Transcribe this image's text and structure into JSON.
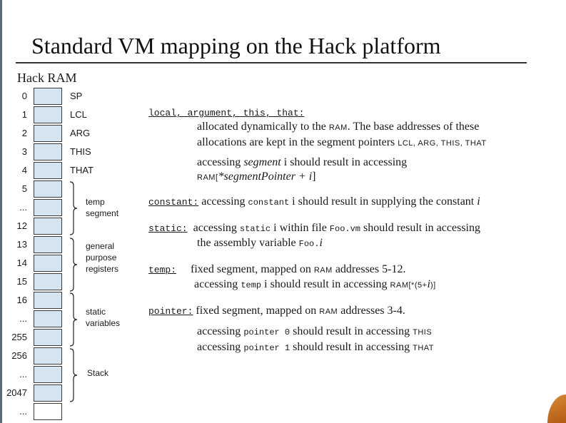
{
  "slide": {
    "title": "Standard VM mapping on the Hack platform",
    "ram_heading": "Hack RAM"
  },
  "ram": {
    "addresses": [
      "0",
      "1",
      "2",
      "3",
      "4",
      "5",
      "...",
      "12",
      "13",
      "14",
      "15",
      "16",
      "...",
      "255",
      "256",
      "...",
      "2047",
      "..."
    ],
    "registers": [
      "SP",
      "LCL",
      "ARG",
      "THIS",
      "THAT"
    ],
    "groups": {
      "temp": [
        "temp",
        "segment"
      ],
      "general": [
        "general",
        "purpose",
        "registers"
      ],
      "static": [
        "static",
        "variables"
      ],
      "stack": [
        "Stack"
      ]
    }
  },
  "segments": {
    "dynamic": {
      "keyword": "local, argument, this, that:",
      "line1": "allocated dynamically to the ",
      "line1_ram": "RAM",
      "line1_end": ". The base addresses of these",
      "line2": "allocations are kept in the segment pointers ",
      "line2_ptrs": "LCL, ARG, THIS, THAT",
      "line3_a": "accessing ",
      "line3_seg": "segment",
      "line3_b": " i should result in accessing",
      "line4_a": "RAM[",
      "line4_b": "*segmentPointer + i",
      "line4_c": "]"
    },
    "constant": {
      "keyword": "constant:",
      "text_a": " accessing ",
      "code": "constant",
      "text_b": " i should result in supplying the constant ",
      "text_c": "i"
    },
    "static": {
      "keyword": "static:",
      "text_a": "accessing ",
      "code": "static",
      "text_b": " i within file ",
      "file": "Foo.vm",
      "text_c": " should result in accessing",
      "line2_a": "the assembly variable ",
      "line2_code": "Foo.",
      "line2_i": "i"
    },
    "temp": {
      "keyword": "temp:",
      "line1_a": "fixed segment, mapped on ",
      "line1_ram": "RAM",
      "line1_b": " addresses 5-12.",
      "line2_a": "accessing ",
      "line2_code": "temp",
      "line2_b": " i should result in accessing ",
      "line2_ram": "RAM[*(5+",
      "line2_i": "i",
      "line2_end": ")]"
    },
    "pointer": {
      "keyword": "pointer:",
      "line1_a": " fixed segment, mapped on ",
      "line1_ram": "RAM",
      "line1_b": " addresses 3-4.",
      "line2_a": "accessing ",
      "line2_code": "pointer 0",
      "line2_b": " should result in accessing ",
      "line2_t": "THIS",
      "line3_a": "accessing ",
      "line3_code": "pointer 1",
      "line3_b": " should result in accessing ",
      "line3_t": "THAT"
    }
  }
}
